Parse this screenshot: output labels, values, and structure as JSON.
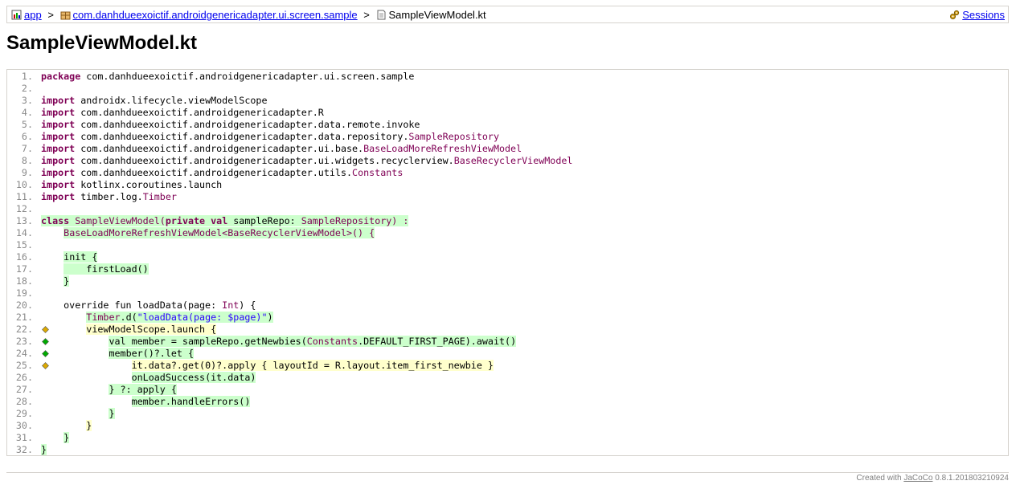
{
  "breadcrumb": {
    "app": "app",
    "package": "com.danhdueexoictif.androidgenericadapter.ui.screen.sample",
    "file": "SampleViewModel.kt",
    "sep": ">",
    "sessions": "Sessions",
    "icons": [
      "report-icon",
      "package-icon",
      "source-file-icon",
      "sessions-icon"
    ]
  },
  "title": "SampleViewModel.kt",
  "colors": {
    "fully_covered": "#ccffcc",
    "partly_covered": "#ffffcc",
    "keyword": "#7f0055",
    "string": "#2a00ff",
    "diamond_full": "#00aa00",
    "diamond_partial": "#ddaa00"
  },
  "lines": [
    {
      "num": "1.",
      "cov": "none",
      "branch": "",
      "segs": [
        {
          "t": "package",
          "c": "kw"
        },
        {
          "t": " com.danhdueexoictif.androidgenericadapter.ui.screen.sample",
          "c": ""
        }
      ]
    },
    {
      "num": "2.",
      "cov": "none",
      "branch": "",
      "segs": []
    },
    {
      "num": "3.",
      "cov": "none",
      "branch": "",
      "segs": [
        {
          "t": "import",
          "c": "kw"
        },
        {
          "t": " androidx.lifecycle.viewModelScope",
          "c": ""
        }
      ]
    },
    {
      "num": "4.",
      "cov": "none",
      "branch": "",
      "segs": [
        {
          "t": "import",
          "c": "kw"
        },
        {
          "t": " com.danhdueexoictif.androidgenericadapter.R",
          "c": ""
        }
      ]
    },
    {
      "num": "5.",
      "cov": "none",
      "branch": "",
      "segs": [
        {
          "t": "import",
          "c": "kw"
        },
        {
          "t": " com.danhdueexoictif.androidgenericadapter.data.remote.invoke",
          "c": ""
        }
      ]
    },
    {
      "num": "6.",
      "cov": "none",
      "branch": "",
      "segs": [
        {
          "t": "import",
          "c": "kw"
        },
        {
          "t": " com.danhdueexoictif.androidgenericadapter.data.repository.",
          "c": ""
        },
        {
          "t": "SampleRepository",
          "c": "cl"
        }
      ]
    },
    {
      "num": "7.",
      "cov": "none",
      "branch": "",
      "segs": [
        {
          "t": "import",
          "c": "kw"
        },
        {
          "t": " com.danhdueexoictif.androidgenericadapter.ui.base.",
          "c": ""
        },
        {
          "t": "BaseLoadMoreRefreshViewModel",
          "c": "cl"
        }
      ]
    },
    {
      "num": "8.",
      "cov": "none",
      "branch": "",
      "segs": [
        {
          "t": "import",
          "c": "kw"
        },
        {
          "t": " com.danhdueexoictif.androidgenericadapter.ui.widgets.recyclerview.",
          "c": ""
        },
        {
          "t": "BaseRecyclerViewModel",
          "c": "cl"
        }
      ]
    },
    {
      "num": "9.",
      "cov": "none",
      "branch": "",
      "segs": [
        {
          "t": "import",
          "c": "kw"
        },
        {
          "t": " com.danhdueexoictif.androidgenericadapter.utils.",
          "c": ""
        },
        {
          "t": "Constants",
          "c": "cl"
        }
      ]
    },
    {
      "num": "10.",
      "cov": "none",
      "branch": "",
      "segs": [
        {
          "t": "import",
          "c": "kw"
        },
        {
          "t": " kotlinx.coroutines.launch",
          "c": ""
        }
      ]
    },
    {
      "num": "11.",
      "cov": "none",
      "branch": "",
      "segs": [
        {
          "t": "import",
          "c": "kw"
        },
        {
          "t": " timber.log.",
          "c": ""
        },
        {
          "t": "Timber",
          "c": "cl"
        }
      ]
    },
    {
      "num": "12.",
      "cov": "none",
      "branch": "",
      "segs": []
    },
    {
      "num": "13.",
      "cov": "fc",
      "branch": "",
      "segs": [
        {
          "t": "class",
          "c": "kw"
        },
        {
          "t": " ",
          "c": ""
        },
        {
          "t": "SampleViewModel(",
          "c": "cl"
        },
        {
          "t": "private val",
          "c": "kw"
        },
        {
          "t": " sampleRepo: ",
          "c": ""
        },
        {
          "t": "SampleRepository) :",
          "c": "cl"
        }
      ]
    },
    {
      "num": "14.",
      "cov": "fc",
      "branch": "",
      "pre": "    ",
      "segs": [
        {
          "t": "BaseLoadMoreRefreshViewModel<BaseRecyclerViewModel>() {",
          "c": "cl"
        }
      ]
    },
    {
      "num": "15.",
      "cov": "none",
      "branch": "",
      "segs": []
    },
    {
      "num": "16.",
      "cov": "fc",
      "branch": "",
      "pre": "    ",
      "segs": [
        {
          "t": "init {",
          "c": ""
        }
      ]
    },
    {
      "num": "17.",
      "cov": "fc",
      "branch": "",
      "pre": "    ",
      "segs": [
        {
          "t": "    firstLoad()",
          "c": ""
        }
      ]
    },
    {
      "num": "18.",
      "cov": "fc",
      "branch": "",
      "pre": "    ",
      "segs": [
        {
          "t": "}",
          "c": ""
        }
      ]
    },
    {
      "num": "19.",
      "cov": "none",
      "branch": "",
      "segs": []
    },
    {
      "num": "20.",
      "cov": "none",
      "branch": "",
      "segs": [
        {
          "t": "    override fun loadData(page: ",
          "c": ""
        },
        {
          "t": "Int",
          "c": "ty"
        },
        {
          "t": ") {",
          "c": ""
        }
      ]
    },
    {
      "num": "21.",
      "cov": "fc",
      "branch": "",
      "pre": "        ",
      "segs": [
        {
          "t": "Timber",
          "c": "cl"
        },
        {
          "t": ".d(",
          "c": ""
        },
        {
          "t": "\"loadData(page: $page)\"",
          "c": "st"
        },
        {
          "t": ")",
          "c": ""
        }
      ]
    },
    {
      "num": "22.",
      "cov": "pc",
      "branch": "partial",
      "pre": "        ",
      "segs": [
        {
          "t": "viewModelScope.launch {",
          "c": ""
        }
      ]
    },
    {
      "num": "23.",
      "cov": "fc",
      "branch": "full",
      "pre": "            ",
      "segs": [
        {
          "t": "val member = sampleRepo.getNewbies(",
          "c": ""
        },
        {
          "t": "Constants",
          "c": "cl"
        },
        {
          "t": ".DEFAULT_FIRST_PAGE).await()",
          "c": ""
        }
      ]
    },
    {
      "num": "24.",
      "cov": "fc",
      "branch": "full",
      "pre": "            ",
      "segs": [
        {
          "t": "member()?.let {",
          "c": ""
        }
      ]
    },
    {
      "num": "25.",
      "cov": "pc",
      "branch": "partial",
      "pre": "                ",
      "segs": [
        {
          "t": "it.data?.get(0)?.apply { layoutId = R.layout.item_first_newbie }",
          "c": ""
        }
      ]
    },
    {
      "num": "26.",
      "cov": "fc",
      "branch": "",
      "pre": "                ",
      "segs": [
        {
          "t": "onLoadSuccess(it.data)",
          "c": ""
        }
      ]
    },
    {
      "num": "27.",
      "cov": "fc",
      "branch": "",
      "pre": "            ",
      "segs": [
        {
          "t": "} ?: apply {",
          "c": ""
        }
      ]
    },
    {
      "num": "28.",
      "cov": "fc",
      "branch": "",
      "pre": "                ",
      "segs": [
        {
          "t": "member.handleErrors()",
          "c": ""
        }
      ]
    },
    {
      "num": "29.",
      "cov": "fc",
      "branch": "",
      "pre": "            ",
      "segs": [
        {
          "t": "}",
          "c": ""
        }
      ]
    },
    {
      "num": "30.",
      "cov": "pc",
      "branch": "",
      "pre": "        ",
      "segs": [
        {
          "t": "}",
          "c": ""
        }
      ]
    },
    {
      "num": "31.",
      "cov": "fc",
      "branch": "",
      "pre": "    ",
      "segs": [
        {
          "t": "}",
          "c": ""
        }
      ]
    },
    {
      "num": "32.",
      "cov": "fc",
      "branch": "",
      "segs": [
        {
          "t": "}",
          "c": ""
        }
      ]
    }
  ],
  "footer": {
    "prefix": "Created with ",
    "link": "JaCoCo",
    "version": " 0.8.1.201803210924"
  }
}
